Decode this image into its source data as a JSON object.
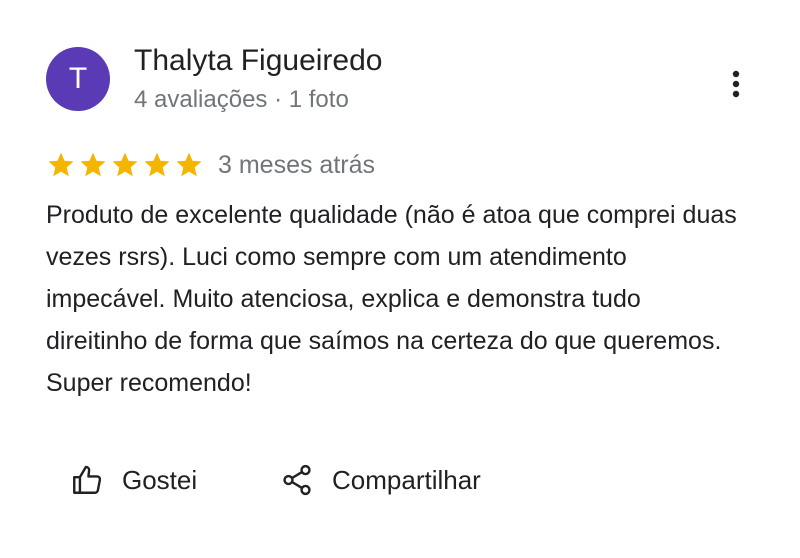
{
  "author": {
    "avatar_letter": "T",
    "name": "Thalyta Figueiredo",
    "meta": "4 avaliações · 1 foto"
  },
  "review": {
    "rating": 5,
    "rating_max": 5,
    "date": "3 meses atrás",
    "text": "Produto de excelente qualidade (não é atoa que comprei duas vezes rsrs). Luci como sempre com um atendimento impecável. Muito atenciosa, explica e demonstra tudo direitinho de forma que saímos na certeza do que queremos. Super recomendo!"
  },
  "actions": {
    "like_label": "Gostei",
    "share_label": "Compartilhar"
  },
  "colors": {
    "avatar_bg": "#5b3bb5",
    "star": "#f4b400",
    "secondary_text": "#70757a",
    "primary_text": "#202124"
  },
  "icons": {
    "more": "more-vert-icon",
    "star": "star-icon",
    "like": "thumb-up-icon",
    "share": "share-icon"
  }
}
